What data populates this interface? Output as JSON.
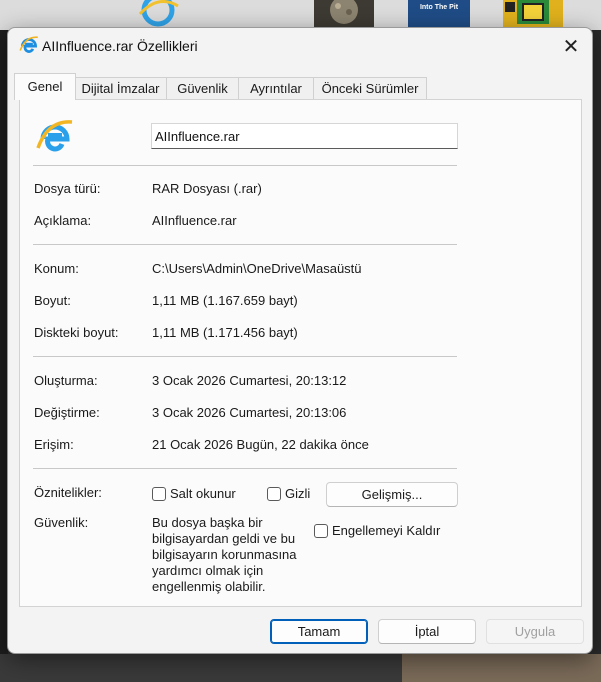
{
  "desktop": {
    "pit_label": "Into The Pit"
  },
  "window": {
    "title": "AIInfluence.rar Özellikleri",
    "title_icon": "ie-icon",
    "close_glyph": "✕"
  },
  "tabs": [
    {
      "label": "Genel",
      "active": true
    },
    {
      "label": "Dijital İmzalar",
      "active": false
    },
    {
      "label": "Güvenlik",
      "active": false
    },
    {
      "label": "Ayrıntılar",
      "active": false
    },
    {
      "label": "Önceki Sürümler",
      "active": false
    }
  ],
  "general": {
    "file_icon": "internet-explorer-icon",
    "file_name": "AIInfluence.rar",
    "rows": {
      "type": {
        "label": "Dosya türü:",
        "value": "RAR Dosyası (.rar)"
      },
      "description": {
        "label": "Açıklama:",
        "value": "AIInfluence.rar"
      },
      "location": {
        "label": "Konum:",
        "value": "C:\\Users\\Admin\\OneDrive\\Masaüstü"
      },
      "size": {
        "label": "Boyut:",
        "value": "1,11 MB (1.167.659 bayt)"
      },
      "size_on_disk": {
        "label": "Diskteki boyut:",
        "value": "1,11 MB (1.171.456 bayt)"
      },
      "created": {
        "label": "Oluşturma:",
        "value": "3 Ocak 2026 Cumartesi, 20:13:12"
      },
      "modified": {
        "label": "Değiştirme:",
        "value": "3 Ocak 2026 Cumartesi, 20:13:06"
      },
      "accessed": {
        "label": "Erişim:",
        "value": "21 Ocak 2026 Bugün, 22 dakika önce"
      }
    },
    "attributes": {
      "label": "Öznitelikler:",
      "read_only": {
        "label": "Salt okunur",
        "checked": false
      },
      "hidden": {
        "label": "Gizli",
        "checked": false
      },
      "advanced_button": "Gelişmiş..."
    },
    "security": {
      "label": "Güvenlik:",
      "text": "Bu dosya başka bir bilgisayardan geldi ve bu bilgisayarın korunmasına yardımcı olmak için engellenmiş olabilir.",
      "unblock": {
        "label": "Engellemeyi Kaldır",
        "checked": false
      }
    }
  },
  "buttons": {
    "ok": "Tamam",
    "cancel": "İptal",
    "apply": "Uygula"
  },
  "colors": {
    "accent": "#005fb8",
    "window_bg": "#f3f3f3",
    "panel_bg": "#fbfbfb"
  }
}
